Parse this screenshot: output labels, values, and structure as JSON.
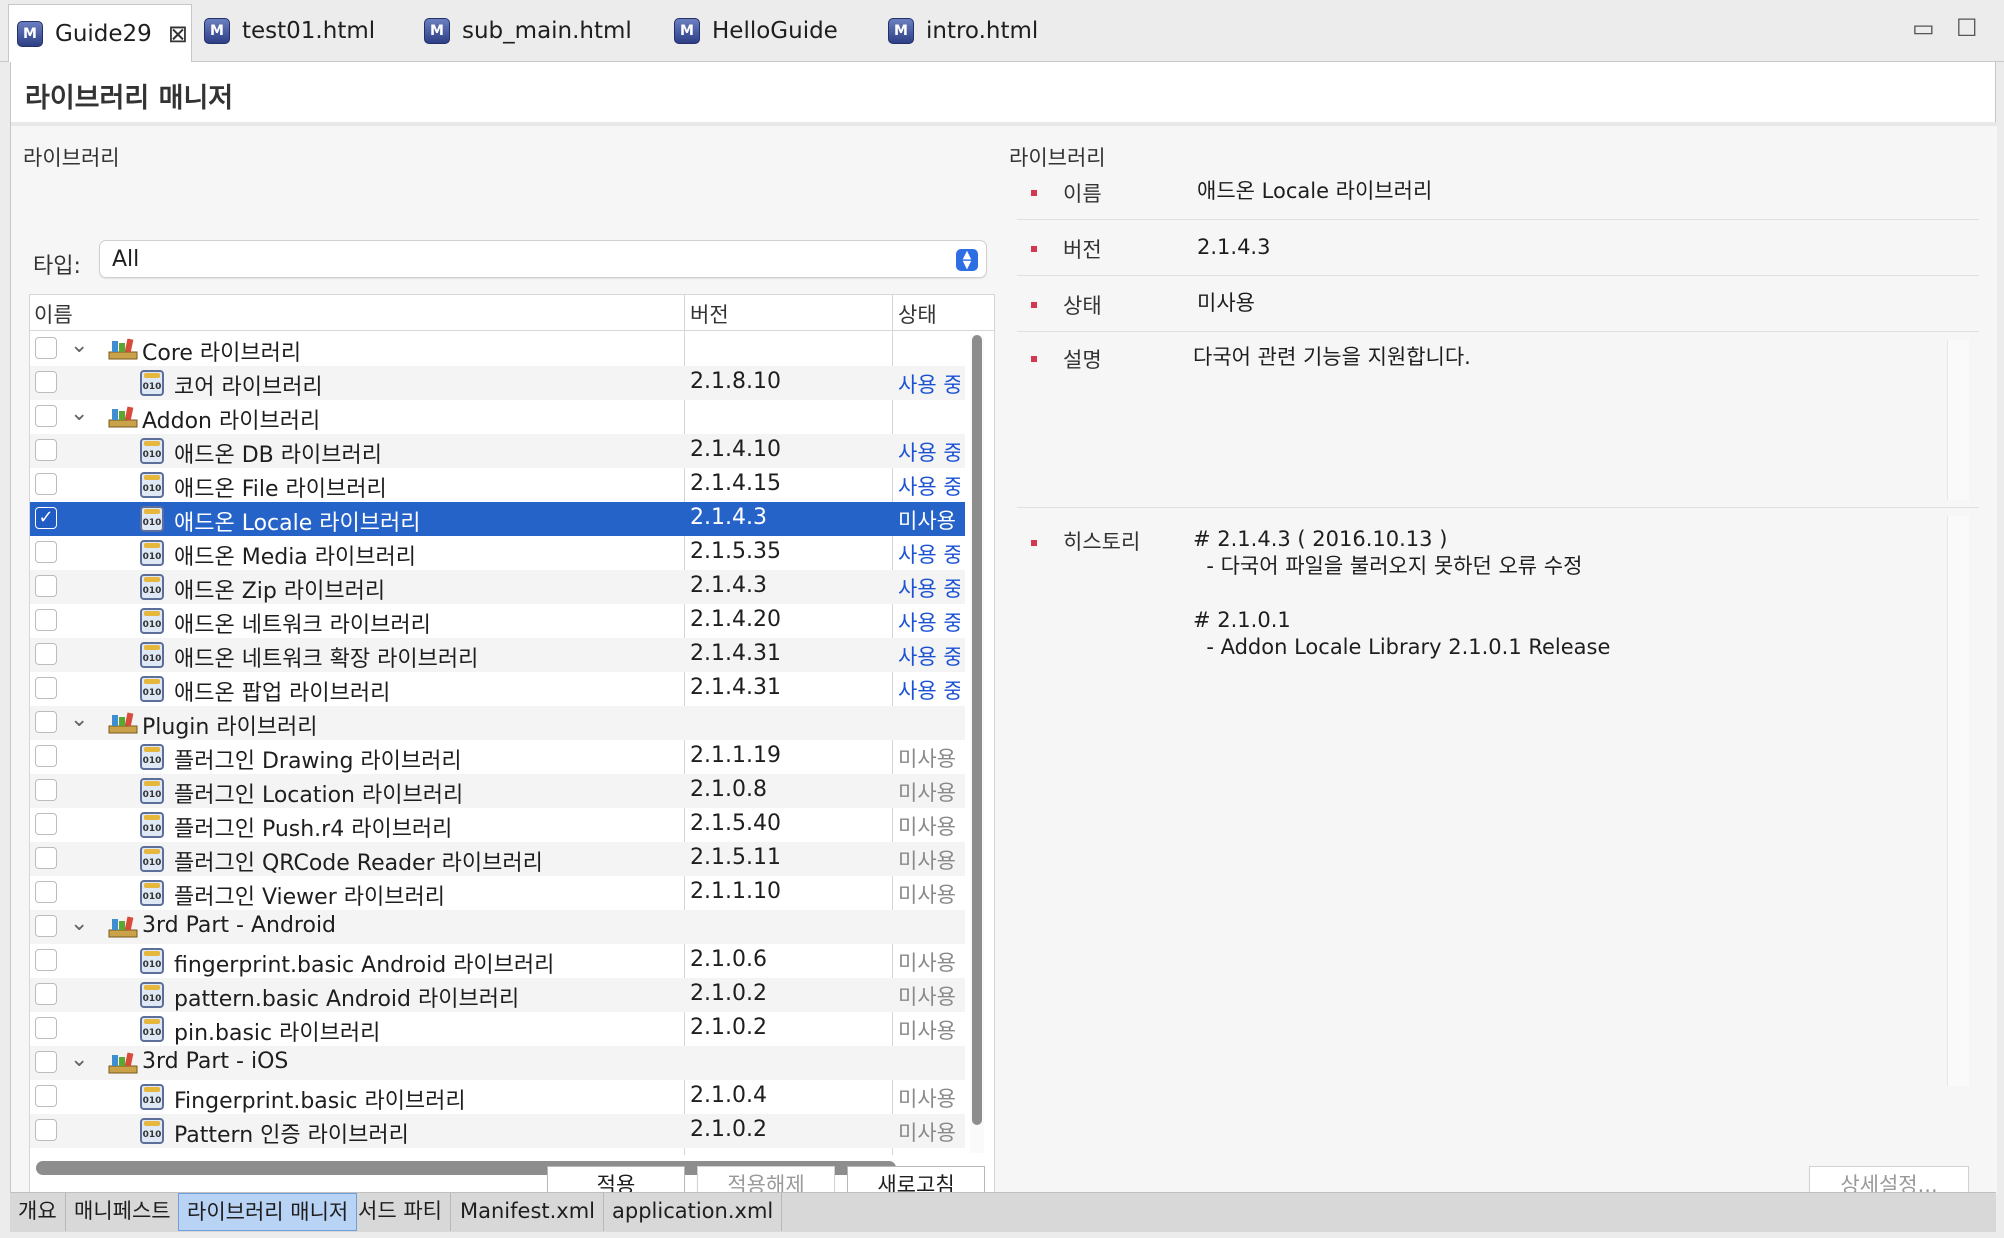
{
  "tabs": [
    {
      "label": "Guide29",
      "active": true
    },
    {
      "label": "test01.html"
    },
    {
      "label": "sub_main.html"
    },
    {
      "label": "HelloGuide"
    },
    {
      "label": "intro.html"
    }
  ],
  "page_title": "라이브러리 매니저",
  "left_section_label": "라이브러리",
  "right_section_label": "라이브러리",
  "type_filter": {
    "label": "타입:",
    "value": "All"
  },
  "columns": {
    "name": "이름",
    "version": "버전",
    "status": "상태"
  },
  "rows": [
    {
      "kind": "group",
      "name": "Core 라이브러리"
    },
    {
      "kind": "item",
      "name": "코어 라이브러리",
      "version": "2.1.8.10",
      "status": "사용 중",
      "used": true
    },
    {
      "kind": "group",
      "name": "Addon 라이브러리"
    },
    {
      "kind": "item",
      "name": "애드온 DB 라이브러리",
      "version": "2.1.4.10",
      "status": "사용 중",
      "used": true
    },
    {
      "kind": "item",
      "name": "애드온 File 라이브러리",
      "version": "2.1.4.15",
      "status": "사용 중",
      "used": true
    },
    {
      "kind": "item",
      "name": "애드온 Locale 라이브러리",
      "version": "2.1.4.3",
      "status": "미사용",
      "selected": true,
      "checked": true
    },
    {
      "kind": "item",
      "name": "애드온 Media 라이브러리",
      "version": "2.1.5.35",
      "status": "사용 중",
      "used": true
    },
    {
      "kind": "item",
      "name": "애드온 Zip 라이브러리",
      "version": "2.1.4.3",
      "status": "사용 중",
      "used": true
    },
    {
      "kind": "item",
      "name": "애드온 네트워크 라이브러리",
      "version": "2.1.4.20",
      "status": "사용 중",
      "used": true
    },
    {
      "kind": "item",
      "name": "애드온 네트워크 확장 라이브러리",
      "version": "2.1.4.31",
      "status": "사용 중",
      "used": true
    },
    {
      "kind": "item",
      "name": "애드온 팝업 라이브러리",
      "version": "2.1.4.31",
      "status": "사용 중",
      "used": true
    },
    {
      "kind": "group",
      "name": "Plugin 라이브러리"
    },
    {
      "kind": "item",
      "name": "플러그인 Drawing 라이브러리",
      "version": "2.1.1.19",
      "status": "미사용"
    },
    {
      "kind": "item",
      "name": "플러그인 Location 라이브러리",
      "version": "2.1.0.8",
      "status": "미사용"
    },
    {
      "kind": "item",
      "name": "플러그인 Push.r4 라이브러리",
      "version": "2.1.5.40",
      "status": "미사용"
    },
    {
      "kind": "item",
      "name": "플러그인 QRCode Reader 라이브러리",
      "version": "2.1.5.11",
      "status": "미사용"
    },
    {
      "kind": "item",
      "name": "플러그인 Viewer 라이브러리",
      "version": "2.1.1.10",
      "status": "미사용"
    },
    {
      "kind": "group",
      "name": "3rd Part - Android"
    },
    {
      "kind": "item",
      "name": "fingerprint.basic Android 라이브러리",
      "version": "2.1.0.6",
      "status": "미사용"
    },
    {
      "kind": "item",
      "name": "pattern.basic Android 라이브러리",
      "version": "2.1.0.2",
      "status": "미사용"
    },
    {
      "kind": "item",
      "name": "pin.basic 라이브러리",
      "version": "2.1.0.2",
      "status": "미사용"
    },
    {
      "kind": "group",
      "name": "3rd Part - iOS"
    },
    {
      "kind": "item",
      "name": "Fingerprint.basic 라이브러리",
      "version": "2.1.0.4",
      "status": "미사용"
    },
    {
      "kind": "item",
      "name": "Pattern 인증 라이브러리",
      "version": "2.1.0.2",
      "status": "미사용"
    }
  ],
  "buttons": {
    "apply": "적용",
    "unapply": "적용해제",
    "refresh": "새로고침",
    "detail_settings": "상세설정..."
  },
  "details": {
    "name_label": "이름",
    "name_value": "애드온 Locale 라이브러리",
    "version_label": "버전",
    "version_value": "2.1.4.3",
    "status_label": "상태",
    "status_value": "미사용",
    "description_label": "설명",
    "description_value": "다국어 관련 기능을 지원합니다.",
    "history_label": "히스토리",
    "history_value": "# 2.1.4.3 ( 2016.10.13 )\n  - 다국어 파일을 불러오지 못하던 오류 수정\n\n# 2.1.0.1\n  - Addon Locale Library 2.1.0.1 Release"
  },
  "page_tabs": [
    {
      "label": "개요"
    },
    {
      "label": "매니페스트"
    },
    {
      "label": "라이브러리 매니저",
      "active": true
    },
    {
      "label": "서드 파티"
    },
    {
      "label": "Manifest.xml"
    },
    {
      "label": "application.xml"
    }
  ],
  "colors": {
    "selection": "#2563c9",
    "used_status": "#1b52d4",
    "bullet": "#d2384f",
    "active_page_tab": "#b9d3f5"
  }
}
